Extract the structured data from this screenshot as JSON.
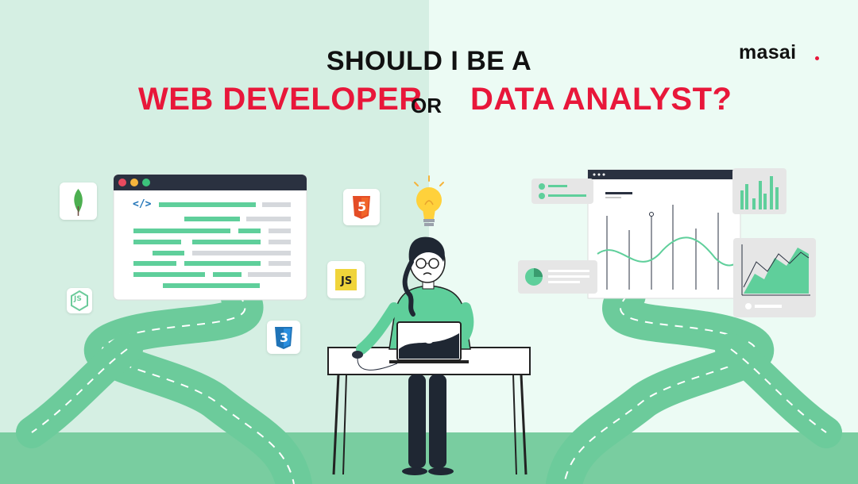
{
  "title": {
    "line1": "SHOULD I BE A",
    "option_a": "WEB DEVELOPER",
    "connector": "OR",
    "option_b": "DATA ANALYST?"
  },
  "brand": {
    "name": "masai"
  },
  "icons": {
    "code_tag": "</>",
    "js_badge": "JS",
    "html_badge": "5",
    "css_badge": "3",
    "node_badge": "JS"
  },
  "colors": {
    "accent_red": "#e8173a",
    "green": "#6ccb9b",
    "dark": "#2a3140"
  }
}
